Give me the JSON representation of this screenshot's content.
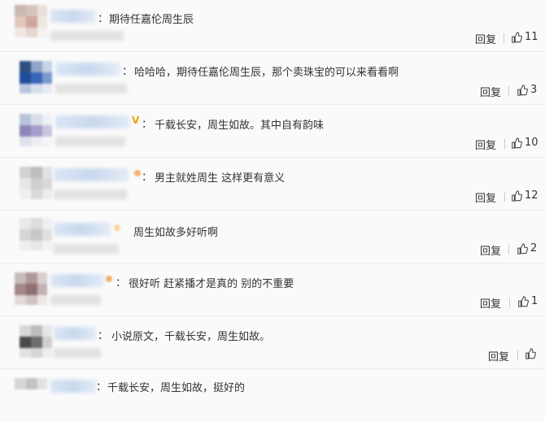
{
  "reply_label": "回复",
  "comments": [
    {
      "text": "期待任嘉伦周生辰",
      "likes": "11"
    },
    {
      "text": "哈哈哈，期待任嘉伦周生辰，那个卖珠宝的可以来看看啊",
      "likes": "3"
    },
    {
      "text": "千载长安，周生如故。其中自有韵味",
      "likes": "10"
    },
    {
      "text": "男主就姓周生 这样更有意义",
      "likes": "12"
    },
    {
      "text": "周生如故多好听啊",
      "likes": "2"
    },
    {
      "text": "很好听 赶紧播才是真的 别的不重要",
      "likes": "1"
    },
    {
      "text": "小说原文，千载长安，周生如故。",
      "likes": ""
    },
    {
      "text": "千载长安，周生如故，挺好的",
      "likes": ""
    }
  ],
  "colors": {
    "text": "#333333",
    "divider": "#e9e9e9",
    "badge": "#e8a400"
  }
}
